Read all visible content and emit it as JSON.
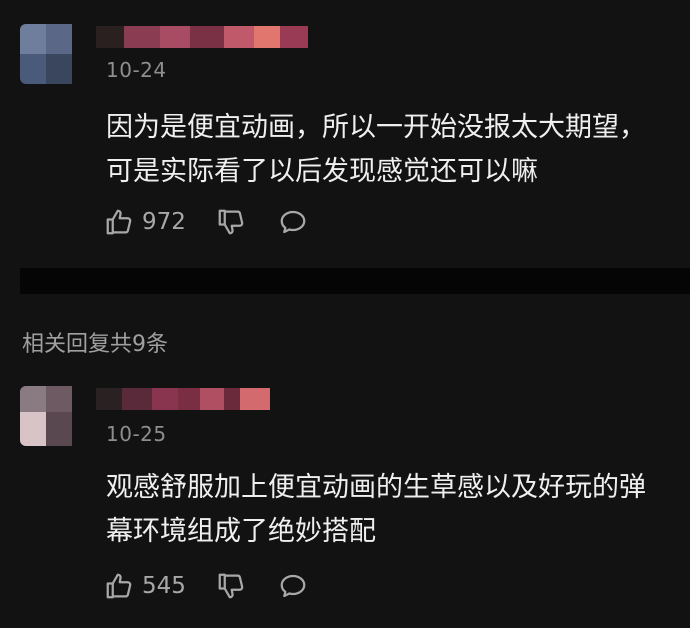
{
  "comments": [
    {
      "date": "10-24",
      "text": "因为是便宜动画，所以一开始没报太大期望，可是实际看了以后发现感觉还可以嘛",
      "likes": "972"
    },
    {
      "date": "10-25",
      "text": "观感舒服加上便宜动画的生草感以及好玩的弹幕环境组成了绝妙搭配",
      "likes": "545"
    }
  ],
  "replies_header": "相关回复共9条",
  "icons": {
    "like": "thumbs-up-icon",
    "dislike": "thumbs-down-icon",
    "reply": "speech-bubble-icon"
  },
  "colors": {
    "background": "#121212",
    "text": "#efefef",
    "muted": "#8e8e8e"
  }
}
